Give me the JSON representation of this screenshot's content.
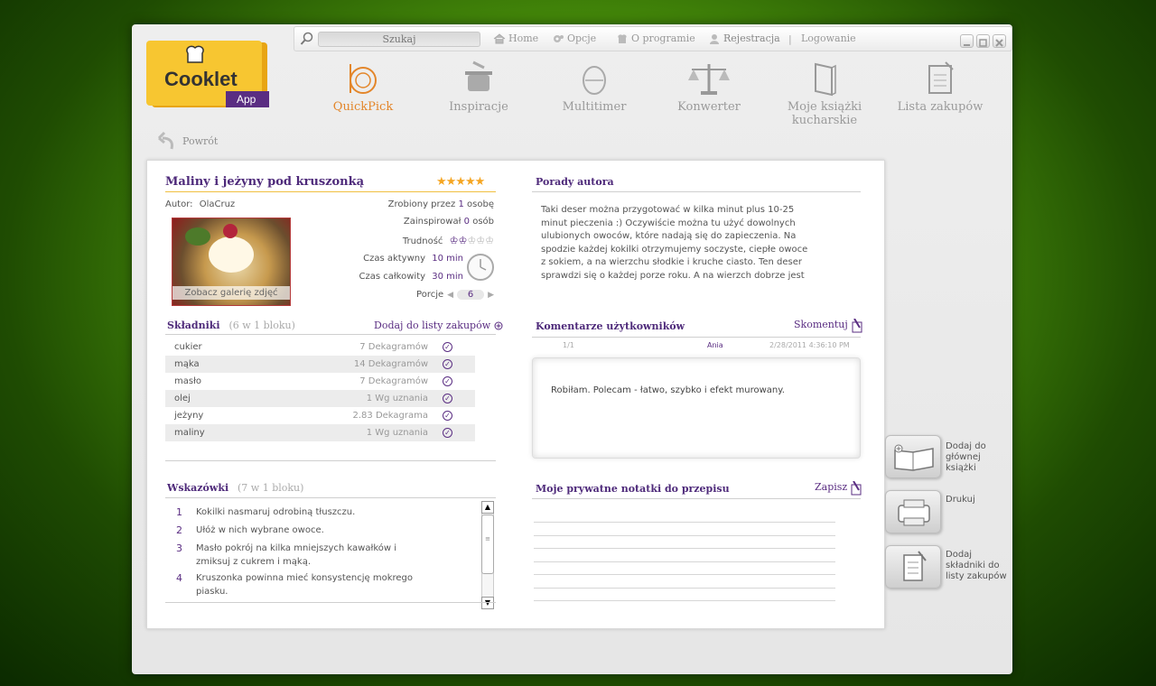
{
  "topbar": {
    "search_placeholder": "Szukaj",
    "home": "Home",
    "options": "Opcje",
    "about": "O programie",
    "register": "Rejestracja",
    "separator": "|",
    "login": "Logowanie"
  },
  "logo": {
    "name": "Cooklet",
    "badge": "App"
  },
  "nav": [
    {
      "label": "QuickPick",
      "icon": "quickpick-icon"
    },
    {
      "label": "Inspiracje",
      "icon": "pot-icon"
    },
    {
      "label": "Multitimer",
      "icon": "egg-timer-icon"
    },
    {
      "label": "Konwerter",
      "icon": "scale-icon"
    },
    {
      "label": "Moje książki kucharskie",
      "icon": "book-icon"
    },
    {
      "label": "Lista zakupów",
      "icon": "list-icon"
    }
  ],
  "back_label": "Powrót",
  "recipe": {
    "title": "Maliny i jeżyny pod kruszonką",
    "stars": "★★★★★",
    "author_label": "Autor:",
    "author": "OlaCruz",
    "gallery": "Zobacz galerię zdjęć",
    "made_prefix": "Zrobiony przez",
    "made_count": "1",
    "made_suffix": "osobę",
    "inspired_prefix": "Zainspirował",
    "inspired_count": "0",
    "inspired_suffix": "osób",
    "difficulty_label": "Trudność",
    "difficulty_level": 2,
    "difficulty_max": 5,
    "active_time_label": "Czas aktywny",
    "active_time": "10 min",
    "total_time_label": "Czas całkowity",
    "total_time": "30 min",
    "portions_label": "Porcje",
    "portions": "6"
  },
  "ingredients": {
    "title": "Składniki",
    "subtitle": "(6 w 1 bloku)",
    "add_label": "Dodaj do listy zakupów",
    "items": [
      {
        "name": "cukier",
        "qty": "7 Dekagramów"
      },
      {
        "name": "mąka",
        "qty": "14 Dekagramów"
      },
      {
        "name": "masło",
        "qty": "7 Dekagramów"
      },
      {
        "name": "olej",
        "qty": "1 Wg uznania"
      },
      {
        "name": "jeżyny",
        "qty": "2.83 Dekagrama"
      },
      {
        "name": "maliny",
        "qty": "1 Wg uznania"
      }
    ]
  },
  "tips": {
    "title": "Wskazówki",
    "subtitle": "(7 w 1 bloku)",
    "items": [
      {
        "n": "1",
        "text": "Kokilki nasmaruj odrobiną tłuszczu."
      },
      {
        "n": "2",
        "text": "Ułóż w nich wybrane owoce."
      },
      {
        "n": "3",
        "text": "Masło pokrój na kilka mniejszych kawałków i zmiksuj z cukrem i mąką."
      },
      {
        "n": "4",
        "text": "Kruszonka powinna mieć konsystencję mokrego piasku."
      }
    ]
  },
  "advice": {
    "title": "Porady autora",
    "text": "Taki deser można przygotować w kilka minut plus 10-25 minut pieczenia :) Oczywiście można tu użyć dowolnych ulubionych owoców, które nadają się do zapieczenia. Na spodzie każdej kokilki otrzymujemy soczyste, ciepłe owoce z sokiem, a na wierzchu słodkie i kruche ciasto. Ten deser sprawdzi się o każdej porze roku. A na wierzch dobrze jest"
  },
  "comments": {
    "title": "Komentarze użytkowników",
    "action": "Skomentuj",
    "page": "1/1",
    "user": "Ania",
    "date": "2/28/2011 4:36:10 PM",
    "text": "Robiłam. Polecam - łatwo, szybko i efekt murowany."
  },
  "notes": {
    "title": "Moje prywatne notatki do przepisu",
    "action": "Zapisz"
  },
  "side_actions": [
    {
      "label": "Dodaj do głównej książki",
      "icon": "open-book-icon"
    },
    {
      "label": "Drukuj",
      "icon": "printer-icon"
    },
    {
      "label": "Dodaj składniki do listy zakupów",
      "icon": "shopping-list-icon"
    }
  ],
  "colors": {
    "accent": "#5a2d82",
    "active_nav": "#e3862a",
    "stars": "#f5a623",
    "logo": "#f7c631"
  }
}
